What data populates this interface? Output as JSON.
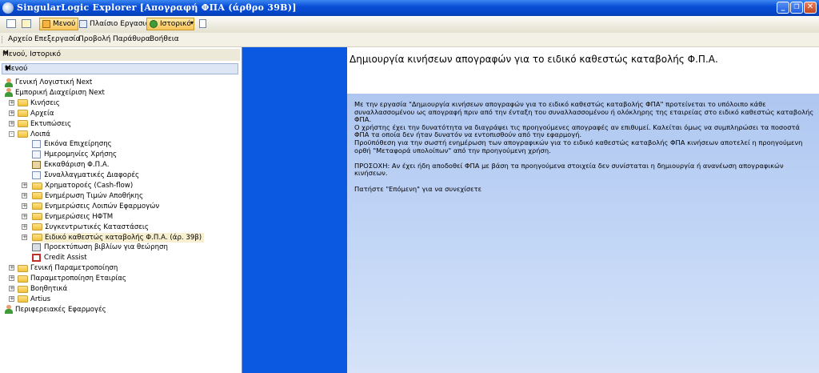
{
  "window": {
    "title": "SingularLogic Explorer [Απογραφή ΦΠΑ (άρθρο 39Β)]",
    "controls": [
      "_",
      "❐",
      "✕"
    ]
  },
  "toolbar": {
    "menu_label": "Μενού",
    "tasks_label": "Πλαίσιο Εργασιών",
    "history_label": "Ιστορικό"
  },
  "menubar": {
    "items": [
      "Αρχείο",
      "Επεξεργασία",
      "Προβολή",
      "Παράθυρα",
      "Βοήθεια"
    ]
  },
  "left_panel": {
    "header": "Μενού, Ιστορικό",
    "subheader": "Μενού",
    "tree": [
      {
        "label": "Γενική Λογιστική Next",
        "icon": "person-icon",
        "level": 0,
        "expander": null
      },
      {
        "label": "Εμπορική Διαχείριση Next",
        "icon": "person-icon",
        "level": 0,
        "expander": null
      },
      {
        "label": "Κινήσεις",
        "icon": "folder-icon",
        "level": 1,
        "expander": "+"
      },
      {
        "label": "Αρχεία",
        "icon": "folder-icon",
        "level": 1,
        "expander": "+"
      },
      {
        "label": "Εκτυπώσεις",
        "icon": "folder-icon",
        "level": 1,
        "expander": "+"
      },
      {
        "label": "Λοιπά",
        "icon": "folder-icon",
        "level": 1,
        "expander": "-"
      },
      {
        "label": "Εικόνα Επιχείρησης",
        "icon": "document-icon",
        "level": 2,
        "expander": null
      },
      {
        "label": "Ημερομηνίες Χρήσης",
        "icon": "document-icon",
        "level": 2,
        "expander": null
      },
      {
        "label": "Εκκαθάριση Φ.Π.Α.",
        "icon": "calculator-icon",
        "level": 2,
        "expander": null
      },
      {
        "label": "Συναλλαγματικές Διαφορές",
        "icon": "document-icon",
        "level": 2,
        "expander": null
      },
      {
        "label": "Χρηματοροές (Cash-flow)",
        "icon": "folder-icon",
        "level": 2,
        "expander": "+"
      },
      {
        "label": "Ενημέρωση Τιμών Αποθήκης",
        "icon": "folder-icon",
        "level": 2,
        "expander": "+"
      },
      {
        "label": "Ενημερώσεις Λοιπών Εφαρμογών",
        "icon": "folder-icon",
        "level": 2,
        "expander": "+"
      },
      {
        "label": "Ενημερώσεις ΗΦΤΜ",
        "icon": "folder-icon",
        "level": 2,
        "expander": "+"
      },
      {
        "label": "Συγκεντρωτικές Καταστάσεις",
        "icon": "folder-icon",
        "level": 2,
        "expander": "+"
      },
      {
        "label": "Ειδικό καθεστώς καταβολής Φ.Π.Α. (άρ. 39β)",
        "icon": "folder-icon",
        "level": 2,
        "expander": "+",
        "selected": true
      },
      {
        "label": "Προεκτύπωση βιβλίων για θεώρηση",
        "icon": "printer-icon",
        "level": 2,
        "expander": null
      },
      {
        "label": "Credit Assist",
        "icon": "credit-assist-icon",
        "level": 2,
        "expander": null
      },
      {
        "label": "Γενική Παραμετροποίηση",
        "icon": "folder-icon",
        "level": 1,
        "expander": "+"
      },
      {
        "label": "Παραμετροποίηση Εταιρίας",
        "icon": "folder-icon",
        "level": 1,
        "expander": "+"
      },
      {
        "label": "Βοηθητικά",
        "icon": "folder-icon",
        "level": 1,
        "expander": "+"
      },
      {
        "label": "Artius",
        "icon": "folder-icon",
        "level": 1,
        "expander": "+"
      },
      {
        "label": "Περιφερειακές Εφαρμογές",
        "icon": "person-icon",
        "level": 0,
        "expander": null
      }
    ]
  },
  "content": {
    "heading": "Δημιουργία κινήσεων απογραφών για το ειδικό καθεστώς καταβολής Φ.Π.Α.",
    "paragraph1": "Με την εργασία \"Δημιουργία κινήσεων απογραφών για το ειδικό καθεστώς καταβολής ΦΠΑ\" προτείνεται το υπόλοιπο κάθε συναλλασσομένου ως απογραφή πριν από την ένταξη του συναλλασσομένου ή ολόκληρης της εταιρείας στο ειδικό καθεστώς καταβολής ΦΠΑ.",
    "paragraph2": "Ο χρήστης έχει την δυνατότητα να διαγράψει τις προηγούμενες απογραφές αν επιθυμεί. Καλείται όμως να συμπληρώσει τα ποσοστά ΦΠΑ τα οποία δεν ήταν δυνατόν να εντοπισθούν από την εφαρμογή.",
    "paragraph3": "Προϋπόθεση για την σωστή ενημέρωση των απογραφικών για το ειδικό καθεστώς καταβολής ΦΠΑ κινήσεων αποτελεί η προηγούμενη ορθή \"Μεταφορά υπολοίπων\" από την προηγούμενη χρήση.",
    "paragraph4": "ΠΡΟΣΟΧΗ: Αν έχει ήδη αποδοθεί ΦΠΑ με βάση τα προηγούμενα στοιχεία δεν συνίσταται η δημιουργία ή ανανέωση απογραφικών κινήσεων.",
    "paragraph5": "Πατήστε \"Επόμενη\" για να συνεχίσετε"
  },
  "colors": {
    "titlebar": "#0a4fd8",
    "blue_strip": "#0a59e0",
    "content_bg": "#c2d6f6"
  }
}
